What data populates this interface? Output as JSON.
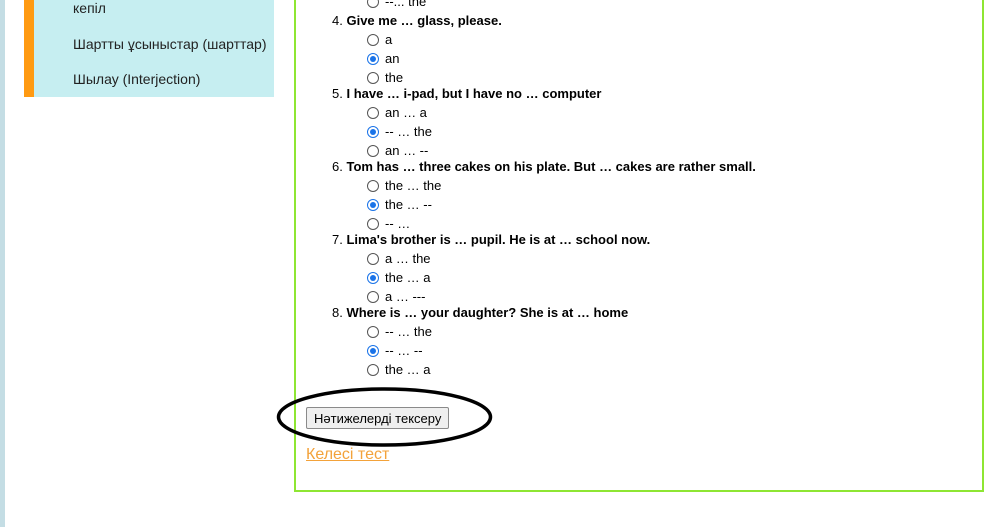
{
  "sidebar": {
    "items": [
      {
        "label": "кепіл"
      },
      {
        "label": "Шартты ұсыныстар (шарттар)"
      },
      {
        "label": "Шылау (Interjection)"
      }
    ]
  },
  "quiz": {
    "top_partial_option": "--... the",
    "questions": [
      {
        "number": "4.",
        "text": "Give me … glass, please.",
        "options": [
          "a",
          "an",
          "the"
        ],
        "selected": 1
      },
      {
        "number": "5.",
        "text": "I have … i-pad, but I have no … computer",
        "options": [
          "an … a",
          "-- … the",
          "an … --"
        ],
        "selected": 1
      },
      {
        "number": "6.",
        "text": "Tom has … three cakes on his plate. But … cakes are rather small.",
        "options": [
          "the … the",
          "the … --",
          "-- …"
        ],
        "selected": 1
      },
      {
        "number": "7.",
        "text": "Lima's brother is … pupil. He is at … school now.",
        "options": [
          "a … the",
          "the … a",
          "a … ---"
        ],
        "selected": 1
      },
      {
        "number": "8.",
        "text": "Where is … your daughter? She is at … home",
        "options": [
          "-- … the",
          "-- … --",
          "the … a"
        ],
        "selected": 1
      }
    ],
    "check_button_label": "Нәтижелерді тексеру",
    "next_link_label": "Келесі тест"
  },
  "colors": {
    "sidebar_bg": "#c6eef1",
    "sidebar_accent": "#ff9a12",
    "content_border": "#8ee633",
    "link": "#f3a23a",
    "radio_checked": "#1a73e8"
  }
}
